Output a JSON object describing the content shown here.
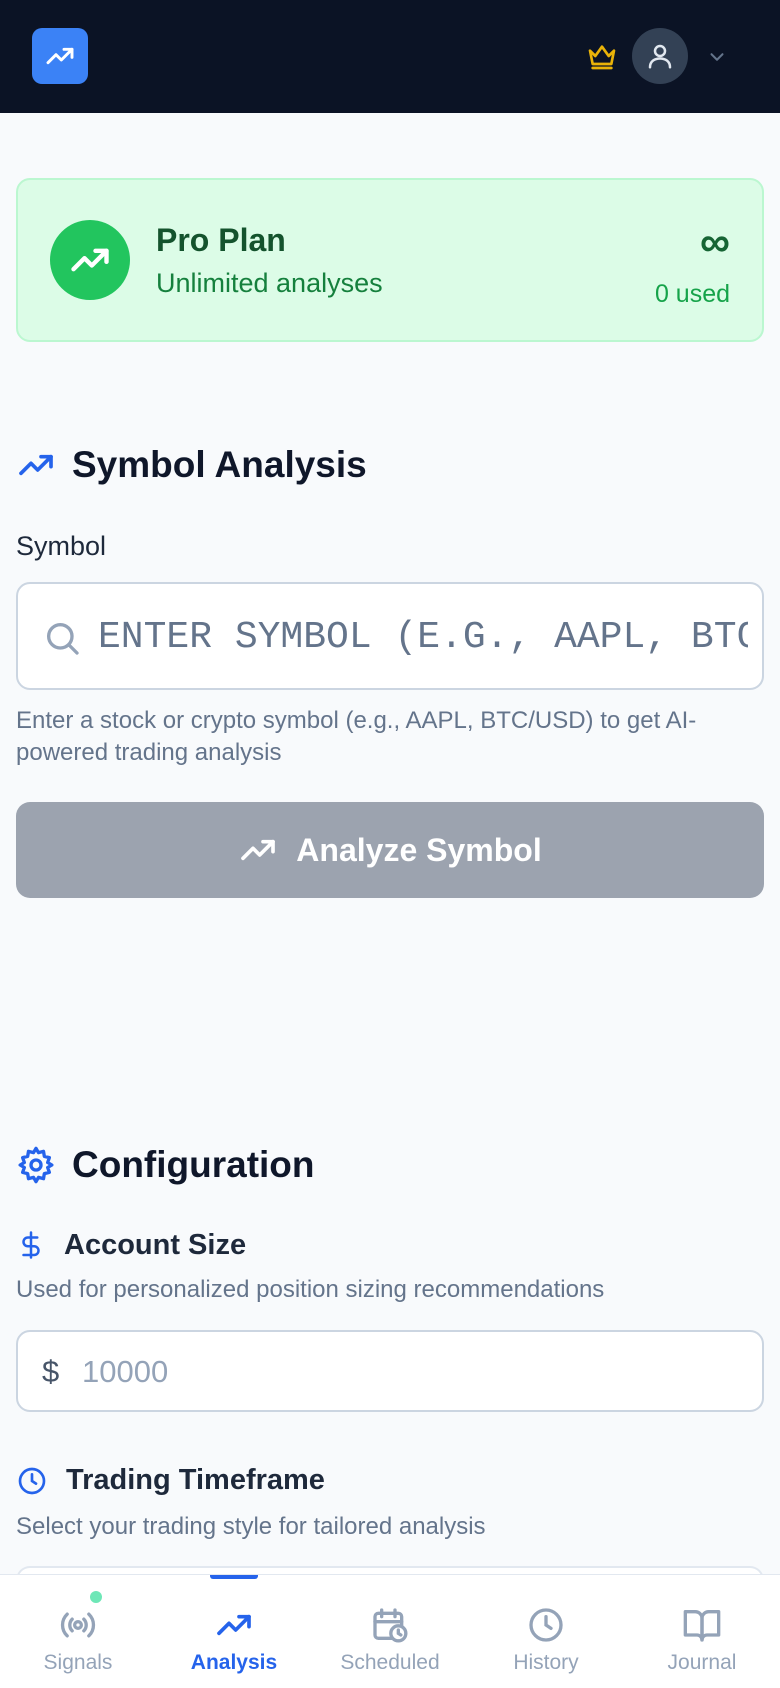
{
  "header": {
    "logo_icon": "trending-up-icon",
    "crown_icon": "crown-icon",
    "crown_color": "#eab308",
    "avatar_icon": "user-icon",
    "menu_icon": "chevron-down-icon"
  },
  "plan": {
    "title": "Pro Plan",
    "subtitle": "Unlimited analyses",
    "limit_symbol": "∞",
    "used": "0 used",
    "accent": "#22c55e"
  },
  "symbol_analysis": {
    "heading": "Symbol Analysis",
    "symbol_label": "Symbol",
    "input_placeholder": "ENTER SYMBOL (E.G., AAPL, BTC/USD)",
    "input_value": "",
    "helper": "Enter a stock or crypto symbol (e.g., AAPL, BTC/USD) to get AI-powered trading analysis",
    "button_label": "Analyze Symbol",
    "button_color": "#9ca3af"
  },
  "configuration": {
    "heading": "Configuration",
    "account_size": {
      "label": "Account Size",
      "helper": "Used for personalized position sizing recommendations",
      "currency": "$",
      "placeholder": "10000"
    },
    "timeframe": {
      "label": "Trading Timeframe",
      "helper": "Select your trading style for tailored analysis"
    }
  },
  "nav": {
    "items": [
      {
        "label": "Signals",
        "icon": "radio-signal-icon"
      },
      {
        "label": "Analysis",
        "icon": "trending-up-icon"
      },
      {
        "label": "Scheduled",
        "icon": "calendar-clock-icon"
      },
      {
        "label": "History",
        "icon": "clock-icon"
      },
      {
        "label": "Journal",
        "icon": "book-open-icon"
      }
    ],
    "active_color": "#2563eb",
    "signal_dot_color": "#6ee7b7"
  }
}
